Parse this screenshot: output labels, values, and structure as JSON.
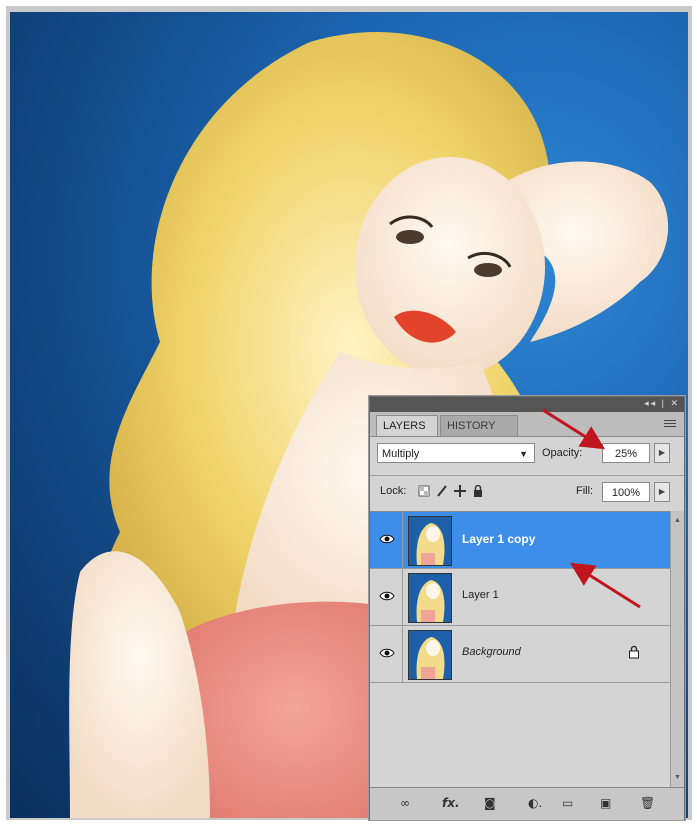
{
  "panel": {
    "tabs": [
      {
        "label": "LAYERS",
        "active": true
      },
      {
        "label": "HISTORY",
        "active": false
      }
    ],
    "blend_mode": "Multiply",
    "opacity_label": "Opacity:",
    "opacity_value": "25%",
    "lock_label": "Lock:",
    "fill_label": "Fill:",
    "fill_value": "100%",
    "layers": [
      {
        "name": "Layer 1 copy",
        "selected": true,
        "visible": true
      },
      {
        "name": "Layer 1",
        "selected": false,
        "visible": true
      },
      {
        "name": "Background",
        "selected": false,
        "visible": true,
        "locked": true
      }
    ],
    "bottom_icons": [
      "link-icon",
      "fx-icon",
      "mask-icon",
      "adjustment-icon",
      "folder-icon",
      "new-layer-icon",
      "trash-icon"
    ],
    "selection_color": "#3d8ee8",
    "annotation_color": "#c0141e"
  }
}
